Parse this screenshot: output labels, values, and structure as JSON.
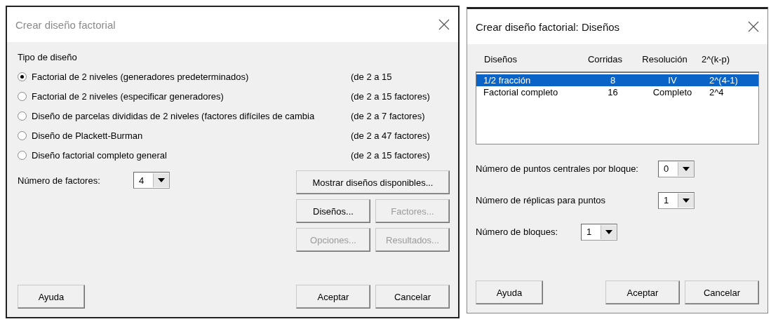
{
  "main_dialog": {
    "title": "Crear diseño factorial",
    "section_label": "Tipo de diseño",
    "design_types": [
      {
        "label": "Factorial de 2 niveles (generadores predeterminados)",
        "range": "(de 2 a 15",
        "selected": true
      },
      {
        "label": "Factorial de 2 niveles (especificar generadores)",
        "range": "(de 2 a 15 factores)",
        "selected": false
      },
      {
        "label": "Diseño de parcelas divididas de 2 niveles (factores difíciles de cambia",
        "range": "(de 2 a 7 factores)",
        "selected": false
      },
      {
        "label": "Diseño de Plackett-Burman",
        "range": "(de 2 a 47 factores)",
        "selected": false
      },
      {
        "label": "Diseño factorial completo general",
        "range": "(de 2 a 15 factores)",
        "selected": false
      }
    ],
    "factors_field": {
      "label": "Número de factores:",
      "value": "4"
    },
    "wide_button": {
      "label": "Mostrar diseños disponibles...",
      "disabled": false
    },
    "side_buttons": [
      {
        "label": "Diseños...",
        "disabled": false
      },
      {
        "label": "Factores...",
        "disabled": true
      },
      {
        "label": "Opciones...",
        "disabled": true
      },
      {
        "label": "Resultados...",
        "disabled": true
      }
    ],
    "help_button": "Ayuda",
    "footer_buttons": [
      "Aceptar",
      "Cancelar"
    ]
  },
  "designs_dialog": {
    "title": "Crear diseño factorial: Diseños",
    "columns": [
      "Diseños",
      "Corridas",
      "Resolución",
      "2^(k-p)"
    ],
    "rows": [
      {
        "cells": [
          "1/2 fracción",
          "8",
          "IV",
          "2^(4-1)"
        ],
        "selected": true
      },
      {
        "cells": [
          "Factorial completo",
          "16",
          "Completo",
          "2^4"
        ],
        "selected": false
      }
    ],
    "fields": [
      {
        "kind": "aligned",
        "label": "Número de puntos centrales por bloque:",
        "value": "0"
      },
      {
        "kind": "aligned",
        "label": "Número de réplicas para puntos",
        "value": "1"
      },
      {
        "kind": "inline",
        "label": "Número de bloques:",
        "value": "1"
      }
    ],
    "help_button": "Ayuda",
    "footer_buttons": [
      "Aceptar",
      "Cancelar"
    ]
  }
}
